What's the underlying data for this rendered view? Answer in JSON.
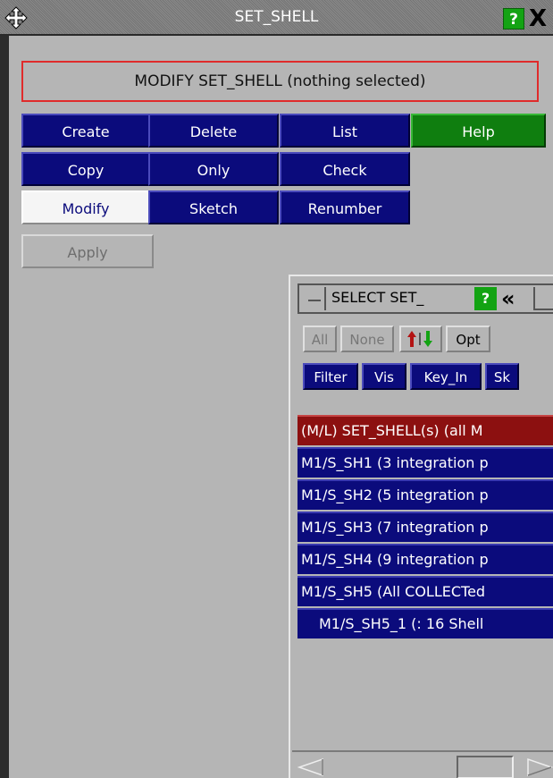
{
  "window": {
    "title": "SET_SHELL",
    "help_label": "?",
    "close_label": "X"
  },
  "mode_banner": "MODIFY SET_SHELL (nothing selected)",
  "actions": {
    "create": "Create",
    "delete": "Delete",
    "list": "List",
    "help": "Help",
    "copy": "Copy",
    "only": "Only",
    "check": "Check",
    "modify": "Modify",
    "sketch": "Sketch",
    "renumber": "Renumber",
    "apply": "Apply"
  },
  "select_panel": {
    "title": "SELECT SET_",
    "help_label": "?",
    "back_label": "«",
    "buttons": {
      "all": "All",
      "none": "None",
      "opt": "Opt",
      "filter": "Filter",
      "vis": "Vis",
      "key_in": "Key_In",
      "sk": "Sk"
    },
    "rows": [
      "(M/L) SET_SHELL(s) (all M",
      "M1/S_SH1 (3 integration p",
      "M1/S_SH2 (5 integration p",
      "M1/S_SH3 (7 integration p",
      "M1/S_SH4 (9 integration p",
      "M1/S_SH5 (All COLLECTed",
      "M1/S_SH5_1 (: 16 Shell"
    ]
  },
  "colors": {
    "button_blue": "#0b0b7c",
    "help_green": "#0f7e0f",
    "header_row_red": "#8c1010",
    "banner_border": "#e02b2b",
    "panel_grey": "#b5b5b5"
  }
}
